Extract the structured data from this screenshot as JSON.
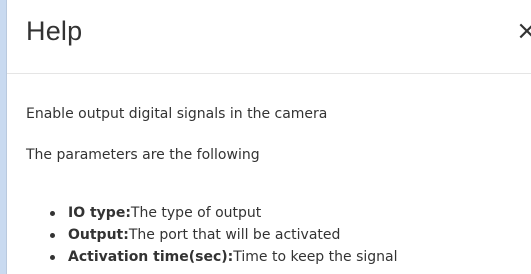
{
  "dialog": {
    "title": "Help",
    "close_label": "×"
  },
  "body": {
    "intro": "Enable output digital signals in the camera",
    "params_heading": "The parameters are the following",
    "params": [
      {
        "name": "IO type:",
        "description": "The type of output"
      },
      {
        "name": "Output:",
        "description": "The port that will be activated"
      },
      {
        "name": "Activation time(sec):",
        "description": "Time to keep the signal"
      }
    ]
  },
  "colors": {
    "text": "#333333",
    "accent": "#c9daf0",
    "divider": "#e5e5e5"
  }
}
